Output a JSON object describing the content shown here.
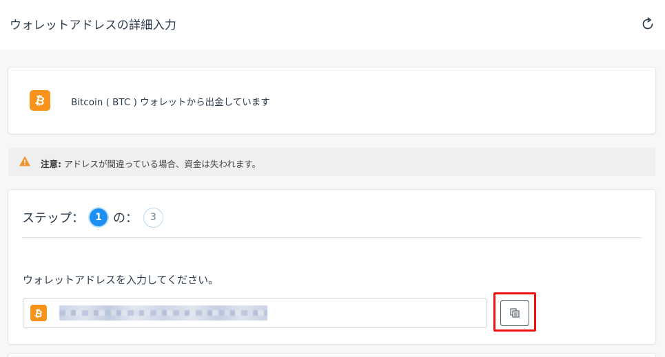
{
  "header": {
    "title": "ウォレットアドレスの詳細入力",
    "refresh_icon": "refresh-icon"
  },
  "currency_card": {
    "coin_icon": "bitcoin-icon",
    "coin_color": "#f7931a",
    "text": "Bitcoin ( BTC ) ウォレットから出金しています"
  },
  "warning": {
    "icon": "warning-triangle-icon",
    "icon_color": "#f0962a",
    "label": "注意:",
    "message": " アドレスが間違っている場合、資金は失われます。"
  },
  "step": {
    "prefix": "ステップ：",
    "current": "1",
    "separator": "の：",
    "total": "3",
    "accent": "#1c8ff0"
  },
  "address_form": {
    "label": "ウォレットアドレスを入力してください。",
    "coin_icon": "bitcoin-icon",
    "value": "",
    "paste_button_icon": "paste-icon",
    "highlight_color": "#ee1111"
  }
}
